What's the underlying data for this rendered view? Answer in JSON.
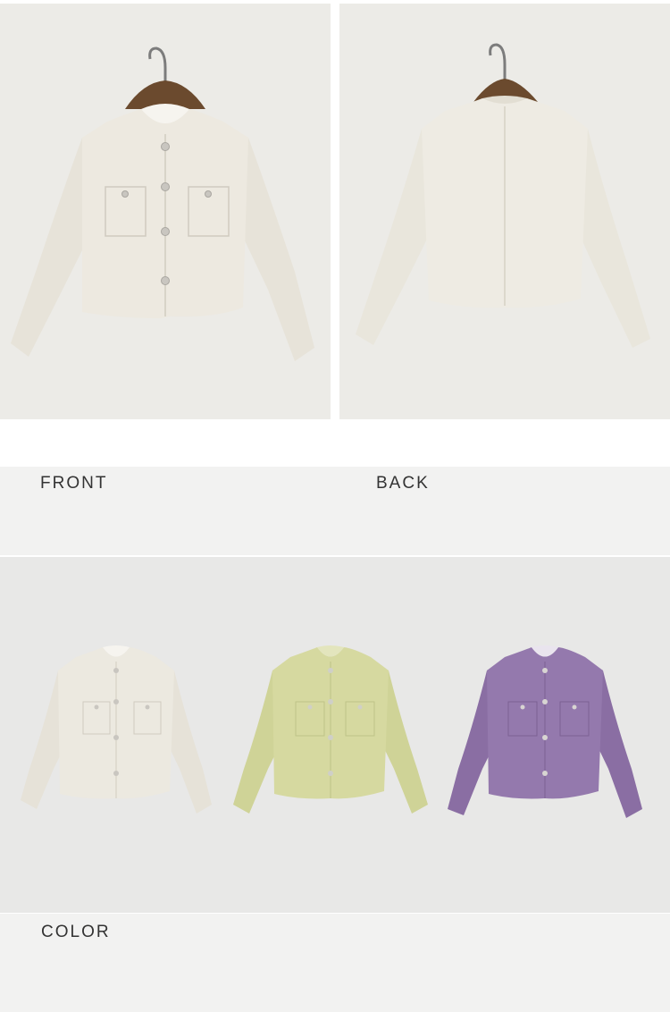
{
  "labels": {
    "front": "FRONT",
    "back": "BACK",
    "color": "COLOR"
  },
  "colors": {
    "photo_background": "#ecebe7",
    "band_background": "#f2f2f1",
    "color_section_background": "#e8e8e7",
    "cream": "#ece9e0",
    "pistachio": "#d6d9a0",
    "lavender": "#9479ad",
    "hanger_wood": "#6b4a2e"
  }
}
